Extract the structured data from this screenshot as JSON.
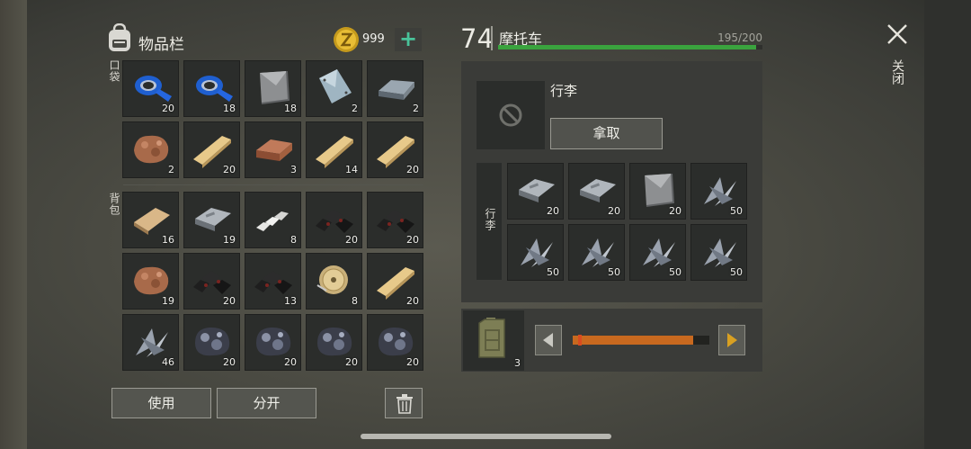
{
  "inventory": {
    "title": "物品栏",
    "coins": "999",
    "add_label": "+",
    "pocket_label": "口袋",
    "backpack_label": "背包",
    "pocket": [
      {
        "icon": "blue-tape-icon",
        "qty": "20"
      },
      {
        "icon": "blue-tape-icon",
        "qty": "18"
      },
      {
        "icon": "metal-plate-icon",
        "qty": "18"
      },
      {
        "icon": "steel-sheet-icon",
        "qty": "2"
      },
      {
        "icon": "iron-ingot-icon",
        "qty": "2"
      },
      {
        "icon": "copper-ore-icon",
        "qty": "2"
      },
      {
        "icon": "plank-icon",
        "qty": "20"
      },
      {
        "icon": "copper-ingot-icon",
        "qty": "3"
      },
      {
        "icon": "plank-icon",
        "qty": "14"
      },
      {
        "icon": "plank-icon",
        "qty": "20"
      }
    ],
    "backpack": [
      {
        "icon": "log-icon",
        "qty": "16"
      },
      {
        "icon": "iron-bar-icon",
        "qty": "19"
      },
      {
        "icon": "aluminum-bars-icon",
        "qty": "8"
      },
      {
        "icon": "coal-icon",
        "qty": "20"
      },
      {
        "icon": "coal-icon",
        "qty": "20"
      },
      {
        "icon": "copper-ore-icon",
        "qty": "19"
      },
      {
        "icon": "coal-icon",
        "qty": "20"
      },
      {
        "icon": "coal-icon",
        "qty": "13"
      },
      {
        "icon": "wire-spool-icon",
        "qty": "8"
      },
      {
        "icon": "plank-icon",
        "qty": "20"
      },
      {
        "icon": "scrap-metal-icon",
        "qty": "46"
      },
      {
        "icon": "iron-ore-icon",
        "qty": "20"
      },
      {
        "icon": "iron-ore-icon",
        "qty": "20"
      },
      {
        "icon": "iron-ore-icon",
        "qty": "20"
      },
      {
        "icon": "iron-ore-icon",
        "qty": "20"
      }
    ],
    "use_label": "使用",
    "split_label": "分开"
  },
  "vehicle": {
    "level": "74",
    "name": "摩托车",
    "capacity": "195/200",
    "capacity_fraction": 0.975,
    "luggage_title": "行李",
    "take_label": "拿取",
    "luggage_label": "行李",
    "luggage": [
      {
        "icon": "iron-bar-icon",
        "qty": "20"
      },
      {
        "icon": "iron-bar-icon",
        "qty": "20"
      },
      {
        "icon": "metal-plate-icon",
        "qty": "20"
      },
      {
        "icon": "scrap-metal-icon",
        "qty": "50"
      },
      {
        "icon": "scrap-metal-icon",
        "qty": "50"
      },
      {
        "icon": "scrap-metal-icon",
        "qty": "50"
      },
      {
        "icon": "scrap-metal-icon",
        "qty": "50"
      },
      {
        "icon": "scrap-metal-icon",
        "qty": "50"
      }
    ],
    "fuel_qty": "3",
    "fuel_level": 0.88
  },
  "close_label": "关闭",
  "colors": {
    "accent_green": "#49c39a",
    "capacity_green": "#3aa33e",
    "fuel_orange": "#c8691f",
    "arrow_gold": "#d8a022"
  }
}
